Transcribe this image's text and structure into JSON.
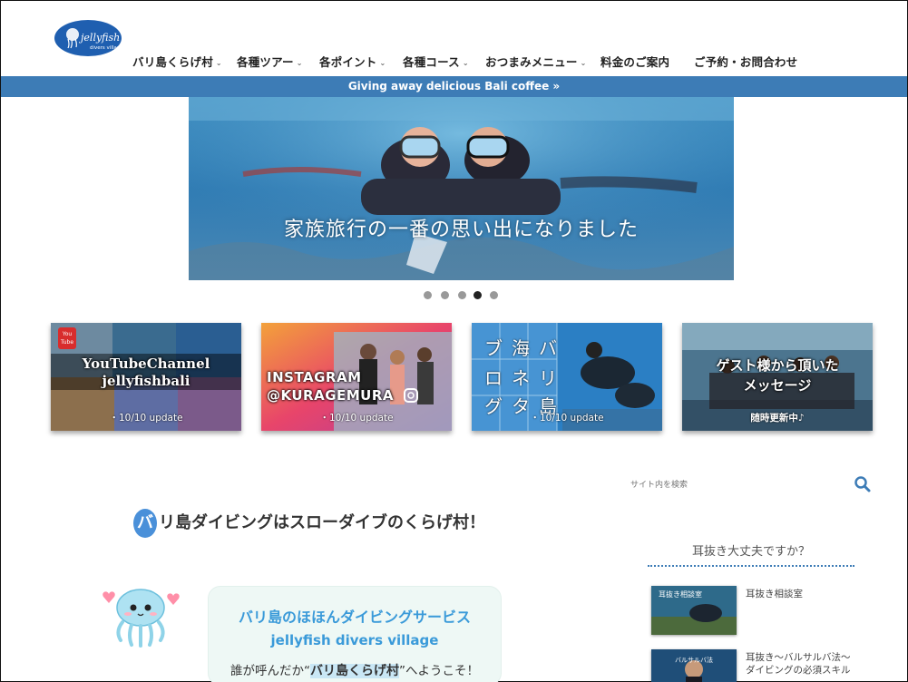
{
  "header": {
    "logo_text": "jellyfish divers village",
    "nav": [
      {
        "label": "バリ島くらげ村",
        "caret": true
      },
      {
        "label": "各種ツアー",
        "caret": true
      },
      {
        "label": "各ポイント",
        "caret": true
      },
      {
        "label": "各種コース",
        "caret": true
      },
      {
        "label": "おつまみメニュー",
        "caret": true
      },
      {
        "label": "料金のご案内",
        "caret": false
      },
      {
        "label": "ご予約・お問合わせ",
        "caret": false
      }
    ]
  },
  "banner": {
    "text": "Giving away delicious Bali coffee »",
    "color": "#3d7cb6"
  },
  "hero": {
    "caption": "家族旅行の一番の思い出になりました",
    "slide_count": 5,
    "active_slide": 4
  },
  "cards": [
    {
      "title_line1": "YouTubeChannel",
      "title_line2": "jellyfishbali",
      "badge": "You Tube",
      "update": "・10/10 update"
    },
    {
      "title_line1": "INSTAGRAM",
      "title_line2": "@KURAGEMURA",
      "update": "・10/10 update"
    },
    {
      "chars": [
        "ブ",
        "海",
        "バ",
        "ロ",
        "ネ",
        "リ",
        "グ",
        "タ",
        "島"
      ],
      "update": "・10/10 update"
    },
    {
      "title_line1": "ゲスト様から頂いた",
      "title_line2": "メッセージ",
      "update": "随時更新中♪"
    }
  ],
  "main": {
    "heading_initial": "バ",
    "heading_rest": "リ島ダイビングはスローダイブのくらげ村！",
    "speech_title": "バリ島のほほんダイビングサービス",
    "speech_sub": "jellyfish divers village",
    "speech_line_pre": "誰が呼んだか“",
    "speech_line_hl": "バリ島くらげ村",
    "speech_line_post": "”へようこそ！"
  },
  "sidebar": {
    "search_placeholder": "サイト内を検索",
    "section_title": "耳抜き大丈夫ですか？",
    "items": [
      {
        "text": "耳抜き相談室",
        "thumb_label": "耳抜き相談室"
      },
      {
        "text": "耳抜き～バルサルバ法～ダイビングの必須スキル",
        "thumb_label": "バルサルバ法"
      }
    ]
  },
  "colors": {
    "accent": "#3d7cb6",
    "heading_circle": "#4a90d9",
    "speech_text": "#3a9ad9"
  }
}
